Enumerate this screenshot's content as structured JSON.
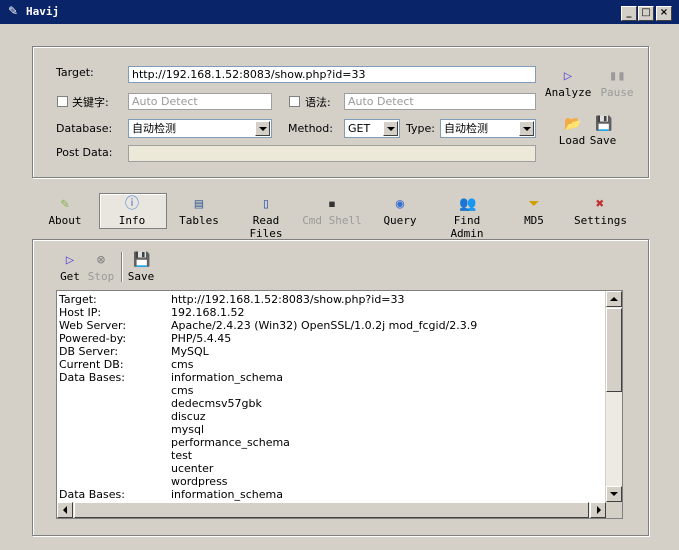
{
  "window": {
    "title": "Havij"
  },
  "form": {
    "target_label": "Target:",
    "target_value": "http://192.168.1.52:8083/show.php?id=33",
    "keyword_label": "关键字:",
    "keyword_placeholder": "Auto Detect",
    "syntax_label": "语法:",
    "syntax_placeholder": "Auto Detect",
    "database_label": "Database:",
    "database_value": "自动检测",
    "method_label": "Method:",
    "method_value": "GET",
    "type_label": "Type:",
    "type_value": "自动检测",
    "postdata_label": "Post Data:",
    "postdata_value": ""
  },
  "side_buttons": {
    "analyze": "Analyze",
    "pause": "Pause",
    "load": "Load",
    "save": "Save"
  },
  "toolbar": {
    "items": [
      {
        "label": "About"
      },
      {
        "label": "Info"
      },
      {
        "label": "Tables"
      },
      {
        "label": "Read Files"
      },
      {
        "label": "Cmd Shell"
      },
      {
        "label": "Query"
      },
      {
        "label": "Find Admin"
      },
      {
        "label": "MD5"
      },
      {
        "label": "Settings"
      }
    ]
  },
  "info_toolbar": {
    "get": "Get",
    "stop": "Stop",
    "save": "Save"
  },
  "output": {
    "rows": [
      {
        "k": "Target:",
        "v": "http://192.168.1.52:8083/show.php?id=33"
      },
      {
        "k": "Host IP:",
        "v": "192.168.1.52"
      },
      {
        "k": "Web Server:",
        "v": "Apache/2.4.23 (Win32) OpenSSL/1.0.2j mod_fcgid/2.3.9"
      },
      {
        "k": "Powered-by:",
        "v": "PHP/5.4.45"
      },
      {
        "k": "DB Server:",
        "v": "MySQL"
      },
      {
        "k": "Current DB:",
        "v": "cms"
      },
      {
        "k": "Data Bases:",
        "v": "information_schema"
      },
      {
        "k": "",
        "v": "cms"
      },
      {
        "k": "",
        "v": "dedecmsv57gbk"
      },
      {
        "k": "",
        "v": "discuz"
      },
      {
        "k": "",
        "v": "mysql"
      },
      {
        "k": "",
        "v": "performance_schema"
      },
      {
        "k": "",
        "v": "test"
      },
      {
        "k": "",
        "v": "ucenter"
      },
      {
        "k": "",
        "v": "wordpress"
      },
      {
        "k": "Data Bases:",
        "v": "information_schema"
      }
    ]
  }
}
